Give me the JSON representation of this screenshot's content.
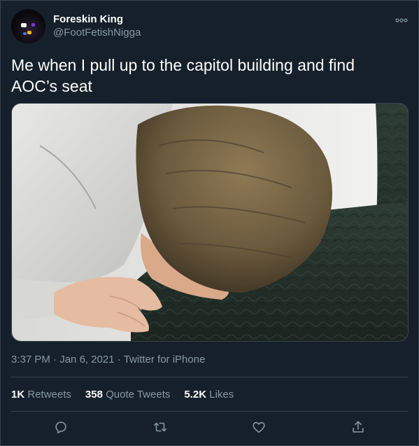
{
  "author": {
    "display_name": "Foreskin King",
    "handle": "@FootFetishNigga"
  },
  "tweet": {
    "text_line1": "Me when I pull up to the capitol building and find",
    "text_line2": "AOC’s seat"
  },
  "meta": {
    "time": "3:37 PM",
    "separator": " · ",
    "date": "Jan 6, 2021",
    "source": "Twitter for iPhone"
  },
  "stats": {
    "retweets_count": "1K",
    "retweets_label": " Retweets",
    "quotes_count": "358",
    "quotes_label": " Quote Tweets",
    "likes_count": "5.2K",
    "likes_label": " Likes"
  },
  "icons": {
    "more": "more-icon",
    "reply": "reply-icon",
    "retweet": "retweet-icon",
    "like": "like-icon",
    "share": "share-icon"
  },
  "colors": {
    "background": "#15202b",
    "border": "#38444d",
    "secondary_text": "#8899a6",
    "primary_text": "#ffffff"
  }
}
